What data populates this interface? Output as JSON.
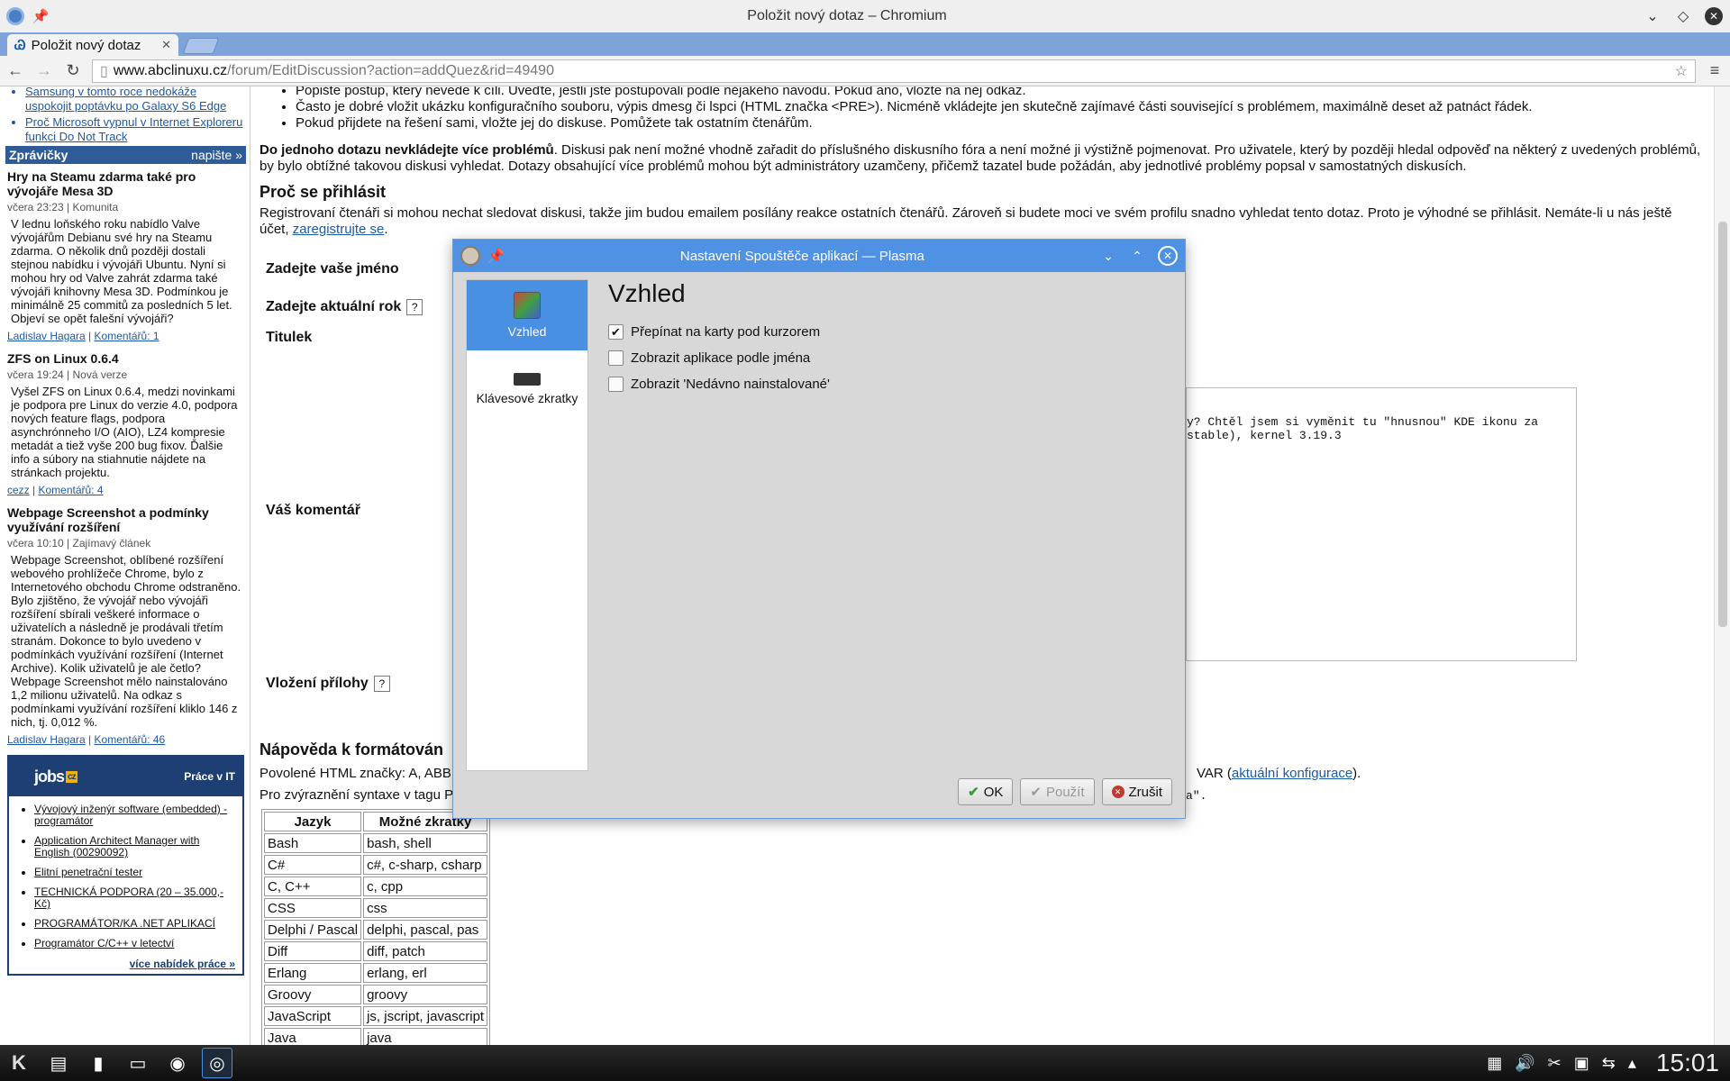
{
  "window": {
    "title": "Položit nový dotaz – Chromium"
  },
  "browser": {
    "tab_label": "Položit nový dotaz",
    "url_host": "www.abclinuxu.cz",
    "url_path": "/forum/EditDiscussion?action=addQuez&rid=49490"
  },
  "sidebar": {
    "top_links": [
      "Samsung v tomto roce nedokáže uspokojit poptávku po Galaxy S6 Edge",
      "Proč Microsoft vypnul v Internet Exploreru funkci Do Not Track"
    ],
    "header": "Zprávičky",
    "header_more": "napište »",
    "news": [
      {
        "title": "Hry na Steamu zdarma také pro vývojáře Mesa 3D",
        "meta": "včera 23:23 | Komunita",
        "body": "V lednu loňského roku nabídlo Valve vývojářům Debianu své hry na Steamu zdarma. O několik dnů později dostali stejnou nabídku i vývojáři Ubuntu. Nyní si mohou hry od Valve zahrát zdarma také vývojáři knihovny Mesa 3D. Podmínkou je minimálně 25 commitů za posledních 5 let. Objeví se opět falešní vývojáři?",
        "author": "Ladislav Hagara",
        "comments": "Komentářů: 1"
      },
      {
        "title": "ZFS on Linux 0.6.4",
        "meta": "včera 19:24 | Nová verze",
        "body": "Vyšel ZFS on Linux 0.6.4, medzi novinkami je podpora pre Linux do verzie 4.0, podpora nových feature flags, podpora asynchrónneho I/O (AIO), LZ4 kompresie metadát a tiež vyše 200 bug fixov. Ďalšie info a súbory na stiahnutie nájdete na stránkach projektu.",
        "author": "cezz",
        "comments": "Komentářů: 4"
      },
      {
        "title": "Webpage Screenshot a podmínky využívání rozšíření",
        "meta": "včera 10:10 | Zajímavý článek",
        "body": "Webpage Screenshot, oblíbené rozšíření webového prohlížeče Chrome, bylo z Internetového obchodu Chrome odstraněno. Bylo zjištěno, že vývojář nebo vývojáři rozšíření sbírali veškeré informace o uživatelích a následně je prodávali třetím stranám. Dokonce to bylo uvedeno v podmínkách využívání rozšíření (Internet Archive). Kolik uživatelů je ale četlo? Webpage Screenshot mělo nainstalováno 1,2 milionu uživatelů. Na odkaz s podmínkami využívání rozšíření kliklo 146 z nich, tj. 0,012 %.",
        "author": "Ladislav Hagara",
        "comments": "Komentářů: 46"
      }
    ],
    "jobs": {
      "logo": "jobs",
      "logo_tag": "cz",
      "tagline": "Práce v IT",
      "items": [
        "Vývojový inženýr software (embedded) - programátor",
        "Application Architect Manager with English (00290092)",
        "Elitní penetrační tester",
        "TECHNICKÁ PODPORA (20 – 35.000,- Kč)",
        "PROGRAMÁTOR/KA .NET APLIKACÍ",
        "Programátor C/C++ v letectví"
      ],
      "more": "více nabídek práce »"
    }
  },
  "main": {
    "bullets": [
      "Popište postup, který nevede k cíli. Uveďte, jestli jste postupovali podle nějakého návodu. Pokud ano, vložte na něj odkaz.",
      "Často je dobré vložit ukázku konfiguračního souboru, výpis dmesg či lspci (HTML značka <PRE>). Nicméně vkládejte jen skutečně zajímavé části související s problémem, maximálně deset až patnáct řádek.",
      "Pokud přijdete na řešení sami, vložte jej do diskuse. Pomůžete tak ostatním čtenářům."
    ],
    "para1_bold": "Do jednoho dotazu nevkládejte více problémů",
    "para1_rest": ". Diskusi pak není možné vhodně zařadit do příslušného diskusního fóra a není možné ji výstižně pojmenovat. Pro uživatele, který by později hledal odpověď na některý z uvedených problémů, by bylo obtížné takovou diskusi vyhledat. Dotazy obsahující více problémů mohou být administrátory uzamčeny, přičemž tazatel bude požádán, aby jednotlivé problémy popsal v samostatných diskusích.",
    "h_login": "Proč se přihlásit",
    "para2": "Registrovaní čtenáři si mohou nechat sledovat diskusi, takže jim budou emailem posílány reakce ostatních čtenářů. Zároveň si budete moci ve svém profilu snadno vyhledat tento dotaz. Proto je výhodné se přihlásit. Nemáte-li u nás ještě účet, ",
    "para2_link": "zaregistrujte se",
    "label_name": "Zadejte vaše jméno",
    "label_year": "Zadejte aktuální rok",
    "label_title": "Titulek",
    "label_comment": "Váš komentář",
    "label_attach": "Vložení přílohy",
    "help_mark": "?",
    "textarea_line1": "y? Chtěl jsem si vyměnit tu \"hnusnou\" KDE ikonu za",
    "textarea_line2": "stable), kernel 3.19.3",
    "h_format": "Nápověda k formátován",
    "allowed_tags": "Povolené HTML značky: A, ABB",
    "allowed_tags_tail": "VAR (",
    "config_link": "aktuální konfigurace",
    "syntax_hint": "Pro zvýraznění syntaxe v tagu P",
    "syntax_tail": "a\".",
    "table": {
      "headers": [
        "Jazyk",
        "Možné zkratky"
      ],
      "rows": [
        [
          "Bash",
          "bash, shell"
        ],
        [
          "C#",
          "c#, c-sharp, csharp"
        ],
        [
          "C, C++",
          "c, cpp"
        ],
        [
          "CSS",
          "css"
        ],
        [
          "Delphi / Pascal",
          "delphi, pascal, pas"
        ],
        [
          "Diff",
          "diff, patch"
        ],
        [
          "Erlang",
          "erlang, erl"
        ],
        [
          "Groovy",
          "groovy"
        ],
        [
          "JavaScript",
          "js, jscript, javascript"
        ],
        [
          "Java",
          "java"
        ]
      ]
    }
  },
  "dialog": {
    "title": "Nastavení Spouštěče aplikací — Plasma",
    "categories": [
      "Vzhled",
      "Klávesové zkratky"
    ],
    "heading": "Vzhled",
    "options": [
      {
        "label": "Přepínat na karty pod kurzorem",
        "checked": true
      },
      {
        "label": "Zobrazit aplikace podle jména",
        "checked": false
      },
      {
        "label": "Zobrazit 'Nedávno nainstalované'",
        "checked": false
      }
    ],
    "btn_ok": "OK",
    "btn_apply": "Použít",
    "btn_cancel": "Zrušit"
  },
  "taskbar": {
    "clock": "15:01"
  }
}
